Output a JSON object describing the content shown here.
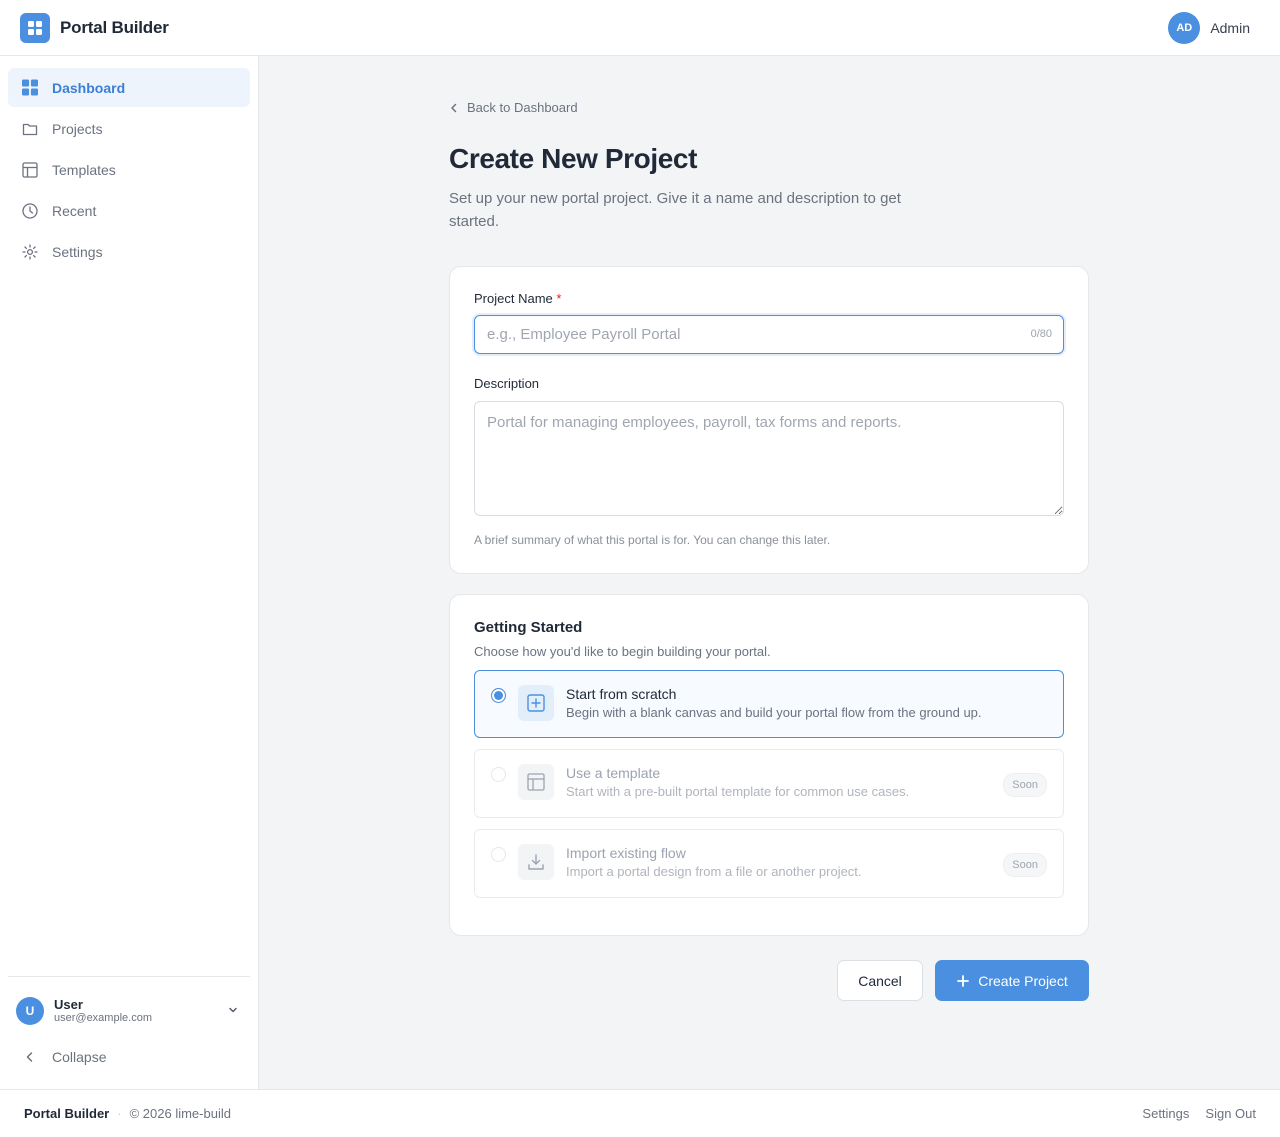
{
  "header": {
    "app_title": "Portal Builder",
    "avatar_initials": "AD",
    "user_label": "Admin",
    "accent_color": "#4a8fe0"
  },
  "sidebar": {
    "items": [
      {
        "label": "Dashboard",
        "icon": "dashboard-grid-icon",
        "active": true
      },
      {
        "label": "Projects",
        "icon": "folder-icon",
        "active": false
      },
      {
        "label": "Templates",
        "icon": "layout-icon",
        "active": false
      },
      {
        "label": "Recent",
        "icon": "clock-icon",
        "active": false
      },
      {
        "label": "Settings",
        "icon": "gear-icon",
        "active": false
      }
    ],
    "user": {
      "initial": "U",
      "name": "User",
      "email": "user@example.com"
    },
    "collapse_label": "Collapse"
  },
  "main": {
    "back_label": "Back to Dashboard",
    "title": "Create New Project",
    "subtitle": "Set up your new portal project. Give it a name and description to get started.",
    "form": {
      "name_label": "Project Name",
      "required_mark": "*",
      "name_value": "",
      "name_placeholder": "e.g., Employee Payroll Portal",
      "name_counter": "0/80",
      "description_label": "Description",
      "description_value": "",
      "description_placeholder": "Portal for managing employees, payroll, tax forms and reports.",
      "description_help": "A brief summary of what this portal is for. You can change this later."
    },
    "getting_started": {
      "title": "Getting Started",
      "subtitle": "Choose how you'd like to begin building your portal.",
      "options": [
        {
          "title": "Start from scratch",
          "description": "Begin with a blank canvas and build your portal flow from the ground up.",
          "selected": true,
          "icon": "plus-square-icon"
        },
        {
          "title": "Use a template",
          "description": "Start with a pre-built portal template for common use cases.",
          "badge": "Soon",
          "disabled": true,
          "icon": "layout-icon"
        },
        {
          "title": "Import existing flow",
          "description": "Import a portal design from a file or another project.",
          "badge": "Soon",
          "disabled": true,
          "icon": "download-icon"
        }
      ]
    },
    "actions": {
      "cancel_label": "Cancel",
      "create_label": "Create Project"
    }
  },
  "footer": {
    "brand": "Portal Builder",
    "separator": "·",
    "copyright": "© 2026 lime-build",
    "links": [
      "Settings",
      "Sign Out"
    ]
  }
}
